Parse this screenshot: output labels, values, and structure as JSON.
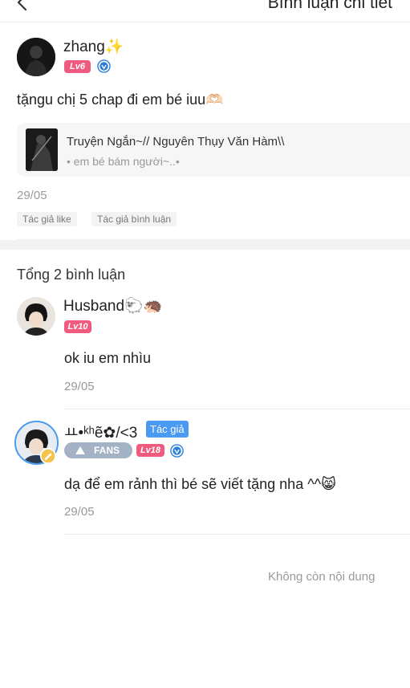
{
  "header": {
    "title": "Bình luận chi tiết"
  },
  "post": {
    "username": "zhang✨",
    "level": "Lv6",
    "text": "tặngu chị 5 chap đi em bé iuu🫶🏻",
    "story": {
      "title": "Truyện Ngắn~// Nguyên Thụy Văn Hàm\\\\",
      "subtitle": "• em bé bám người~..•"
    },
    "date": "29/05",
    "tags": [
      "Tác giả like",
      "Tác giả bình luận"
    ]
  },
  "comments_total": "Tổng 2 bình luận",
  "comments": [
    {
      "username": "Husband🐑🦔",
      "level": "Lv10",
      "text": "ok iu em nhìu",
      "date": "29/05"
    },
    {
      "username": "ㅛ•ᵏʰẽ✿/<3",
      "author_badge": "Tác giả",
      "fans_label": "FANS",
      "level": "Lv18",
      "text": "dạ để em rảnh thì bé sẽ viết tặng nha ^^😸",
      "date": "29/05"
    }
  ],
  "footer": {
    "end_text": "Không còn nội dung"
  },
  "colors": {
    "level_badge": "#f05a7e",
    "author_badge": "#4a9af1",
    "verified": "#2b7fd6"
  },
  "icons": [
    "back-arrow-icon",
    "verified-icon"
  ]
}
